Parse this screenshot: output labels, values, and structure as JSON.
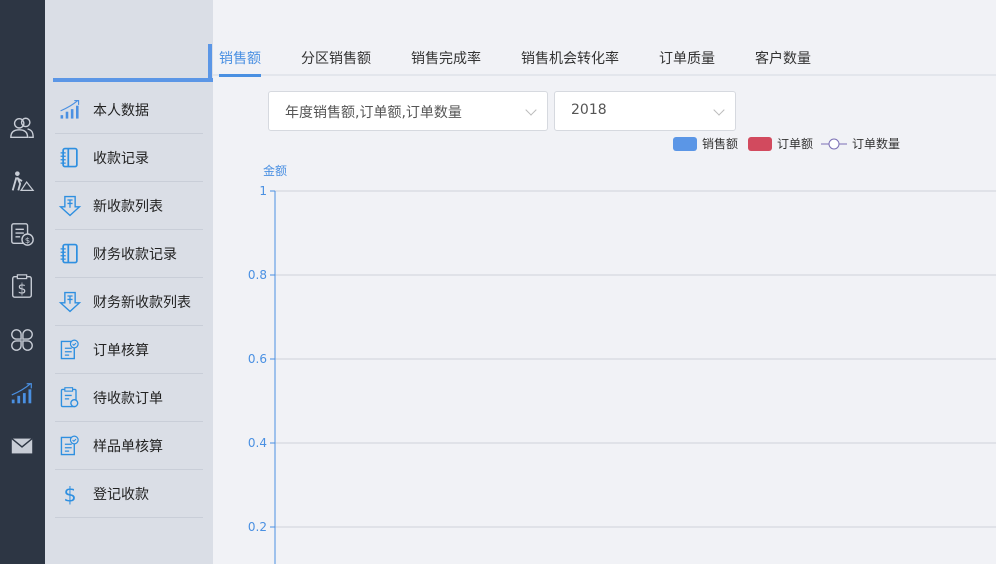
{
  "rail": [
    "users-icon",
    "worker-icon",
    "invoice-dollar-icon",
    "clipboard-dollar-icon",
    "clover-icon",
    "chart-growth-icon",
    "mail-icon"
  ],
  "menu": [
    {
      "label": "本人数据",
      "icon": "chart-growth-icon"
    },
    {
      "label": "收款记录",
      "icon": "notebook-icon"
    },
    {
      "label": "新收款列表",
      "icon": "download-list-icon"
    },
    {
      "label": "财务收款记录",
      "icon": "notebook-icon"
    },
    {
      "label": "财务新收款列表",
      "icon": "download-list-icon"
    },
    {
      "label": "订单核算",
      "icon": "doc-check-icon"
    },
    {
      "label": "待收款订单",
      "icon": "clipboard-gear-icon"
    },
    {
      "label": "样品单核算",
      "icon": "doc-check-icon"
    },
    {
      "label": "登记收款",
      "icon": "dollar-icon"
    }
  ],
  "tabs": [
    "销售额",
    "分区销售额",
    "销售完成率",
    "销售机会转化率",
    "订单质量",
    "客户数量"
  ],
  "filters": {
    "type": "年度销售额,订单额,订单数量",
    "year": "2018"
  },
  "colors": {
    "sales": "#5b96e6",
    "orders": "#d24a5e",
    "count": "#7b6fb5"
  },
  "chart_data": {
    "type": "bar",
    "ylabel": "金额",
    "legend": [
      {
        "name": "销售额",
        "kind": "bar"
      },
      {
        "name": "订单额",
        "kind": "bar"
      },
      {
        "name": "订单数量",
        "kind": "line"
      }
    ],
    "legend_position": "top-right",
    "yticks": [
      "1",
      "0.8",
      "0.6",
      "0.4",
      "0.2"
    ],
    "ylim": [
      0,
      1
    ],
    "grid": true,
    "series": []
  }
}
